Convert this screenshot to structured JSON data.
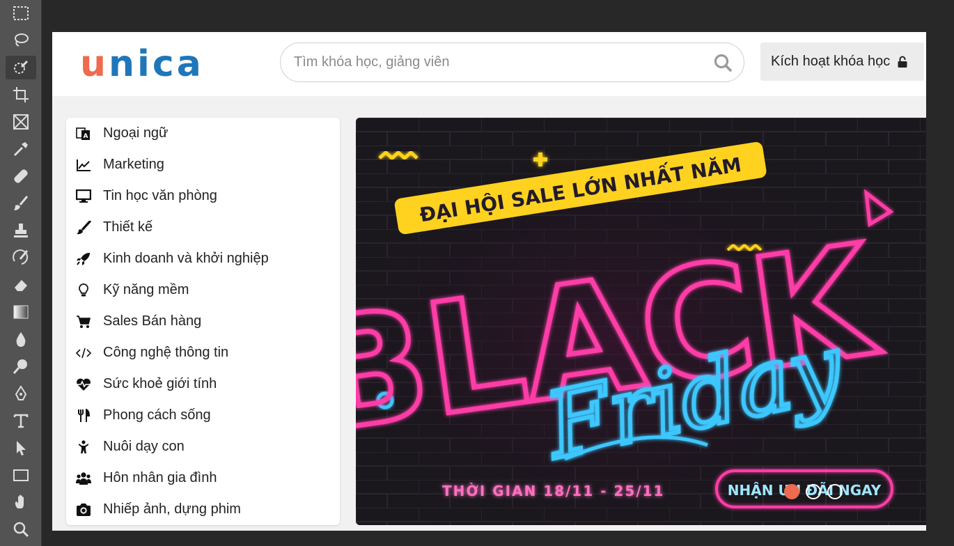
{
  "toolbar": {
    "tools": [
      "marquee-icon",
      "lasso-icon",
      "quick-selection-icon",
      "crop-icon",
      "frame-icon",
      "eyedropper-icon",
      "healing-brush-icon",
      "brush-icon",
      "clone-stamp-icon",
      "history-brush-icon",
      "eraser-icon",
      "gradient-icon",
      "blur-icon",
      "dodge-icon",
      "pen-icon",
      "type-icon",
      "path-selection-icon",
      "rectangle-icon",
      "hand-icon",
      "zoom-icon"
    ]
  },
  "header": {
    "logo_first": "u",
    "logo_rest": "nica",
    "search_placeholder": "Tìm khóa học, giảng viên",
    "activate_label": "Kích hoạt khóa học"
  },
  "menu": {
    "items": [
      {
        "label": "Ngoại ngữ",
        "icon": "language-icon"
      },
      {
        "label": "Marketing",
        "icon": "chart-line-icon"
      },
      {
        "label": "Tin học văn phòng",
        "icon": "monitor-icon"
      },
      {
        "label": "Thiết kế",
        "icon": "paint-brush-icon"
      },
      {
        "label": "Kinh doanh và khởi nghiệp",
        "icon": "rocket-icon"
      },
      {
        "label": "Kỹ năng mềm",
        "icon": "lightbulb-icon"
      },
      {
        "label": "Sales Bán hàng",
        "icon": "cart-icon"
      },
      {
        "label": "Công nghệ thông tin",
        "icon": "code-icon"
      },
      {
        "label": "Sức khoẻ giới tính",
        "icon": "heartbeat-icon"
      },
      {
        "label": "Phong cách sống",
        "icon": "utensils-icon"
      },
      {
        "label": "Nuôi dạy con",
        "icon": "child-icon"
      },
      {
        "label": "Hôn nhân gia đình",
        "icon": "family-icon"
      },
      {
        "label": "Nhiếp ảnh, dựng phim",
        "icon": "camera-icon"
      }
    ]
  },
  "banner": {
    "headline": "ĐẠI HỘI SALE LỚN NHẤT NĂM",
    "title_main": "BLACK",
    "title_script": "Friday",
    "dates": "THỜI GIAN 18/11 - 25/11",
    "cta": "NHẬN ƯU ĐÃI NGAY",
    "slides": 3,
    "active_slide": 1
  },
  "colors": {
    "brand_orange": "#ee6b4f",
    "brand_blue": "#1f76b9",
    "neon_pink": "#ff3da8",
    "neon_blue": "#3ec7ff",
    "neon_yellow": "#ffd21f"
  }
}
